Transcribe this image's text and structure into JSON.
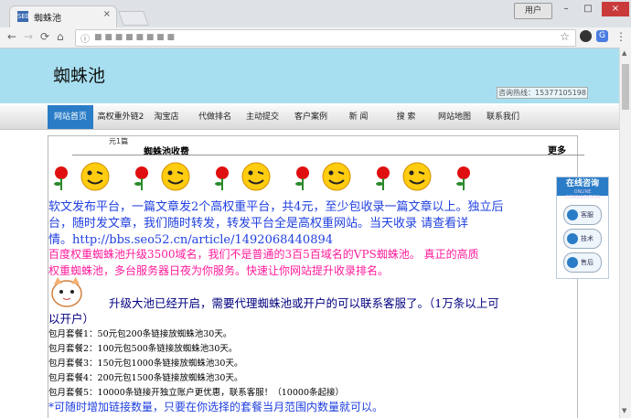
{
  "browser": {
    "tab_title": "蜘蛛池",
    "tab_close": "×",
    "url": "■ ■ ■ ■ ■ ■ ■ ■",
    "user_button": "用户",
    "win_min": "–",
    "win_max": "□",
    "win_close": "×",
    "nav_back": "←",
    "nav_forward": "→",
    "nav_reload": "⟳",
    "nav_home": "⌂",
    "info_icon": "ⓘ",
    "star": "☆",
    "menu": "⋮"
  },
  "site": {
    "logo": "蜘蛛池",
    "hotline": "咨询热线：15377105198"
  },
  "nav": {
    "items": [
      {
        "label": "网站首页"
      },
      {
        "label": "高权重外链2"
      },
      {
        "label": "淘宝店"
      },
      {
        "label": "代做排名"
      },
      {
        "label": "主动提交"
      },
      {
        "label": "客户案例"
      },
      {
        "label": "新  闻"
      },
      {
        "label": "搜  索"
      },
      {
        "label": "网站地图"
      },
      {
        "label": "联系我们"
      }
    ]
  },
  "content": {
    "tab_label": "元1篇",
    "title": "蜘蛛池收费",
    "more": "更多",
    "line1": "软文发布平台，一篇文章发2个高权重平台，共4元，至少包收录一篇文章以上。独立后",
    "line2": "台，随时发文章，我们随时转发，转发平台全是高权重网站。当天收录 请查看详",
    "line3": "情。http://bbs.seo52.cn/article/1492068440894",
    "line4": "百度权重蜘蛛池升级3500域名，我们不是普通的3百5百域名的VPS蜘蛛池。 真正的高质",
    "line5": "权重蜘蛛池，多台服务器日夜为你服务。快速让你网站提升收录排名。",
    "line6": "升级大池已经开启，需要代理蜘蛛池或开户的可以联系客服了。（1万条以上可",
    "line7": "以开户）",
    "packages": [
      "包月套餐1：50元包200条链接放蜘蛛池30天。",
      "包月套餐2：100元包500条链接放蜘蛛池30天。",
      "包月套餐3：150元包1000条链接放蜘蛛池30天。",
      "包月套餐4：200元包1500条链接放蜘蛛池30天。",
      "包月套餐5：10000条链接开独立账户更优惠，联系客服！（10000条起接）"
    ],
    "footer_line": "*可随时增加链接数量，只要在你选择的套餐当月范围内数量就可以。"
  },
  "float_widget": {
    "title": "在线咨询",
    "subtitle": "ONLINE CONSULTATION",
    "buttons": [
      "客服",
      "技术",
      "售后"
    ]
  },
  "colors": {
    "header_bg": "#a8dff0",
    "nav_active": "#2a7cc7",
    "text_blue": "#2040e0",
    "text_pink": "#ff1c9b",
    "text_dark": "#000080"
  }
}
